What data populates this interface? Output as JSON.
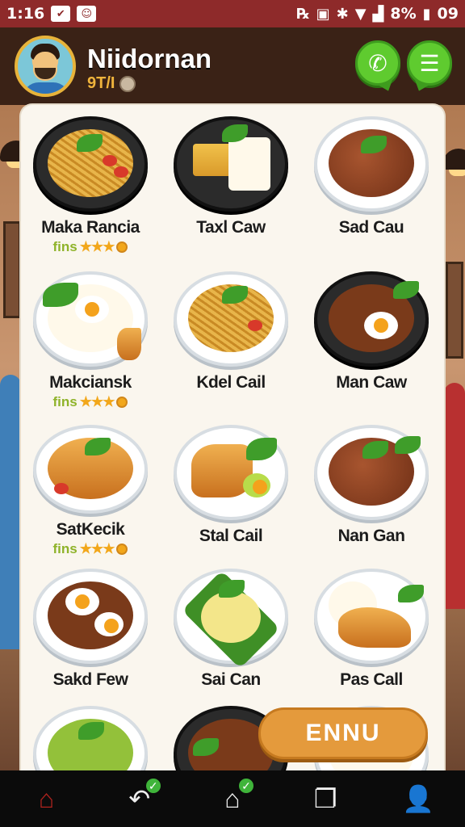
{
  "status_bar": {
    "time": "1:16",
    "battery": "8%",
    "clock": "09"
  },
  "header": {
    "title": "Niidornan",
    "subtitle": "9T/I"
  },
  "dishes": [
    {
      "name": "Maka Rancia",
      "rating_label": "fins",
      "stars": "★★★"
    },
    {
      "name": "Taxl Caw"
    },
    {
      "name": "Sad Cau"
    },
    {
      "name": "Makciansk",
      "rating_label": "fins",
      "stars": "★★★"
    },
    {
      "name": "Kdel Cail"
    },
    {
      "name": "Man Caw"
    },
    {
      "name": "SatKecik",
      "rating_label": "fins",
      "stars": "★★★"
    },
    {
      "name": "Stal Cail"
    },
    {
      "name": "Nan Gan"
    },
    {
      "name": "Sakd Few"
    },
    {
      "name": "Sai Can"
    },
    {
      "name": "Pas Call"
    }
  ],
  "menu_button": {
    "label": "ENNU"
  },
  "navbar": {
    "items": [
      "home-icon",
      "back-icon",
      "house-up-icon",
      "recent-apps-icon",
      "profile-icon"
    ]
  },
  "colors": {
    "status_bar": "#8e2a2a",
    "accent_green": "#5fcb2f",
    "menu_orange": "#e49a3c",
    "rating_green": "#8fb32a",
    "star_gold": "#f2a71b"
  }
}
